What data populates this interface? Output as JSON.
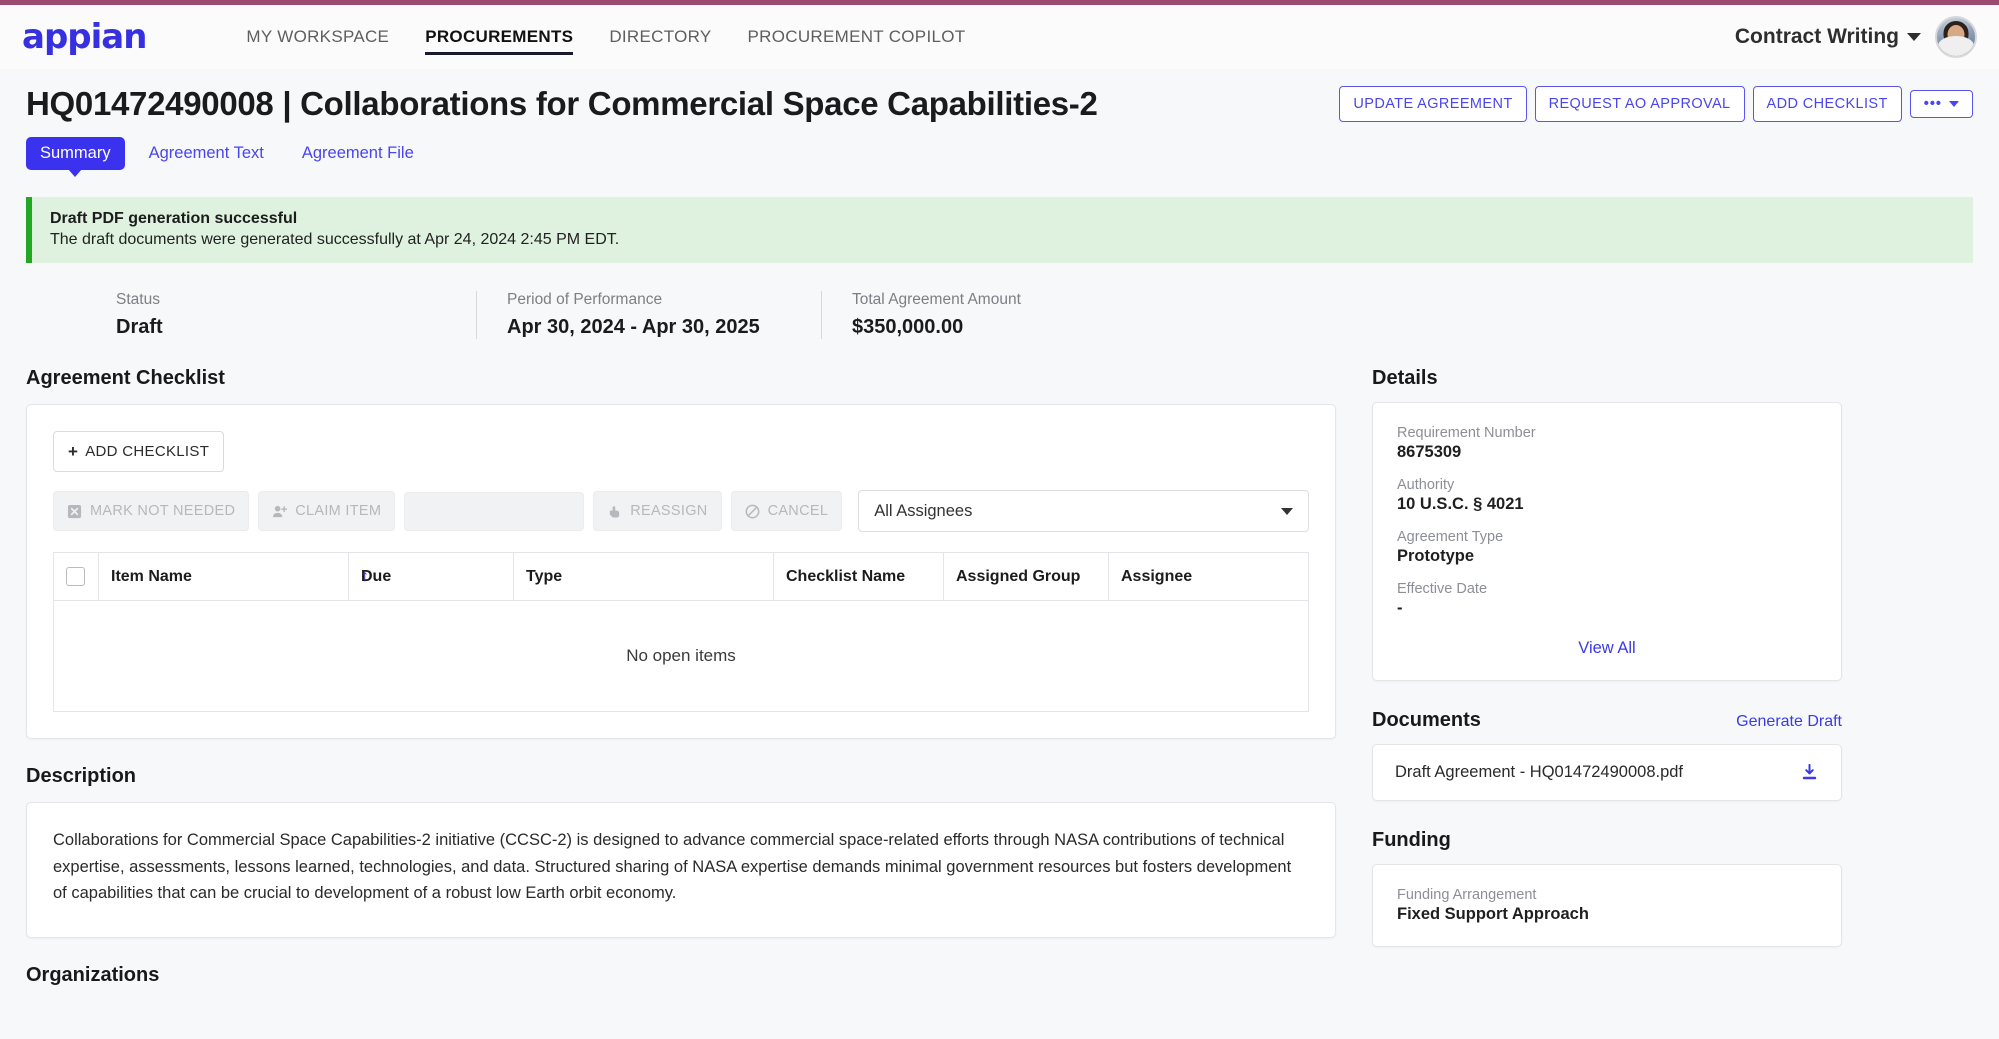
{
  "brand": {
    "logo_text": "appian",
    "accent": "#3a32ee",
    "top_border": "#9c4a6e"
  },
  "topnav": {
    "items": [
      {
        "label": "MY WORKSPACE",
        "active": false
      },
      {
        "label": "PROCUREMENTS",
        "active": true
      },
      {
        "label": "DIRECTORY",
        "active": false
      },
      {
        "label": "PROCUREMENT COPILOT",
        "active": false
      }
    ],
    "user_menu_label": "Contract Writing",
    "avatar_icon": "user-avatar-photo"
  },
  "page": {
    "title": "HQ01472490008 | Collaborations for Commercial Space Capabilities-2",
    "actions": [
      {
        "label": "UPDATE AGREEMENT"
      },
      {
        "label": "REQUEST AO APPROVAL"
      },
      {
        "label": "ADD CHECKLIST"
      }
    ],
    "overflow_label": "•••",
    "tabs": [
      {
        "label": "Summary",
        "active": true
      },
      {
        "label": "Agreement Text",
        "active": false
      },
      {
        "label": "Agreement File",
        "active": false
      }
    ]
  },
  "alert": {
    "status_color": "#22a722",
    "title": "Draft PDF generation successful",
    "message": "The draft documents were generated successfully at Apr 24, 2024 2:45 PM  EDT."
  },
  "summary": [
    {
      "label": "Status",
      "value": "Draft"
    },
    {
      "label": "Period of Performance",
      "value": "Apr 30, 2024 - Apr 30, 2025"
    },
    {
      "label": "Total Agreement Amount",
      "value": "$350,000.00"
    }
  ],
  "checklist": {
    "heading": "Agreement Checklist",
    "add_button": "ADD CHECKLIST",
    "toolbar": [
      {
        "label": "MARK NOT NEEDED",
        "icon": "x-square-icon",
        "disabled": true
      },
      {
        "label": "CLAIM ITEM",
        "icon": "user-add-icon",
        "disabled": true
      },
      {
        "label": "REASSIGN",
        "icon": "hand-pointer-icon",
        "disabled": true
      },
      {
        "label": "CANCEL",
        "icon": "no-entry-icon",
        "disabled": true
      }
    ],
    "search_placeholder": "",
    "assignee_filter": "All Assignees",
    "columns": [
      "Item Name",
      "Due",
      "Type",
      "Checklist Name",
      "Assigned Group",
      "Assignee"
    ],
    "sort_indicator": "↑",
    "empty_message": "No open items"
  },
  "description": {
    "heading": "Description",
    "text": "Collaborations for Commercial Space Capabilities-2 initiative (CCSC-2) is designed to advance commercial space-related efforts through NASA contributions of technical expertise, assessments, lessons learned, technologies, and data. Structured sharing of NASA expertise demands minimal government resources but fosters development of capabilities that can be crucial to development of a robust low Earth orbit economy."
  },
  "organizations": {
    "heading": "Organizations"
  },
  "details": {
    "heading": "Details",
    "fields": [
      {
        "label": "Requirement Number",
        "value": "8675309"
      },
      {
        "label": "Authority",
        "value": "10 U.S.C. § 4021"
      },
      {
        "label": "Agreement Type",
        "value": "Prototype"
      },
      {
        "label": "Effective Date",
        "value": "-"
      }
    ],
    "view_all": "View All"
  },
  "documents": {
    "heading": "Documents",
    "action": "Generate Draft",
    "items": [
      {
        "name": "Draft Agreement - HQ01472490008.pdf",
        "download_icon": "download-icon"
      }
    ]
  },
  "funding": {
    "heading": "Funding",
    "fields": [
      {
        "label": "Funding Arrangement",
        "value": "Fixed Support Approach"
      }
    ]
  }
}
